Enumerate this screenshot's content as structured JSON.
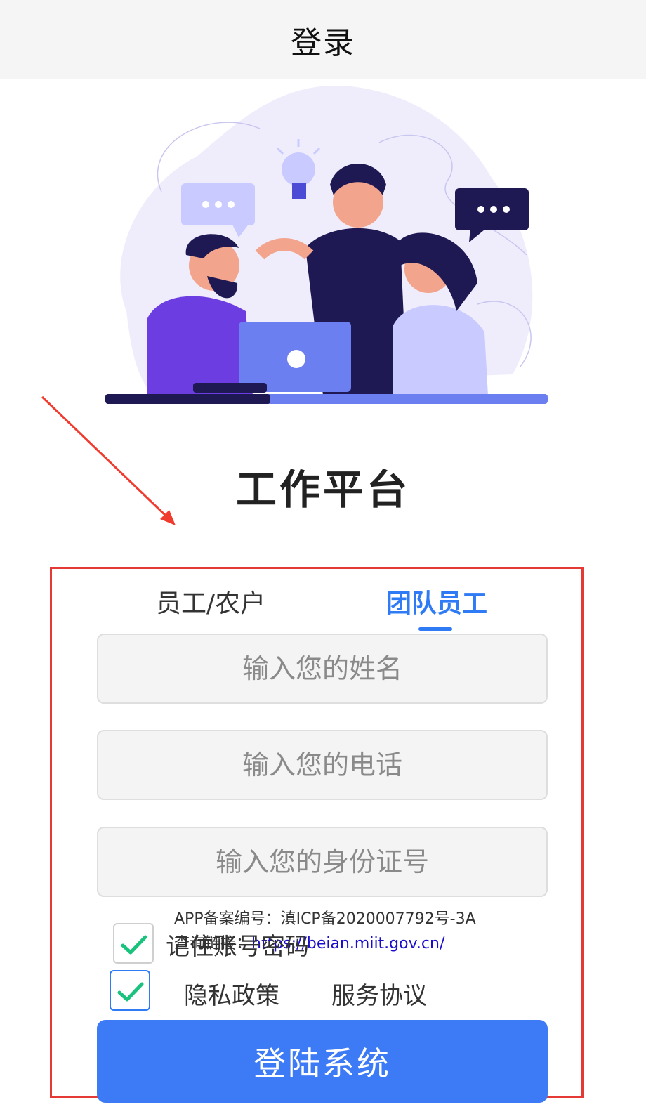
{
  "nav": {
    "title": "登录"
  },
  "platform_title": "工作平台",
  "tabs": [
    {
      "label": "员工/农户",
      "active": false
    },
    {
      "label": "团队员工",
      "active": true
    }
  ],
  "fields": {
    "name_placeholder": "输入您的姓名",
    "phone_placeholder": "输入您的电话",
    "id_placeholder": "输入您的身份证号"
  },
  "icp": {
    "line1": "APP备案编号：滇ICP备2020007792号-3A",
    "line2_prefix": "查询链接：",
    "link": "https://beian.miit.gov.cn/"
  },
  "remember": {
    "label": "记住账号密码",
    "checked": true
  },
  "agreement": {
    "checked": true,
    "privacy": "隐私政策",
    "service": "服务协议"
  },
  "login_button": "登陆系统",
  "colors": {
    "accent": "#3d7af6",
    "tab_active": "#2f7bf5",
    "highlight": "#e53935",
    "check": "#19c37d"
  }
}
